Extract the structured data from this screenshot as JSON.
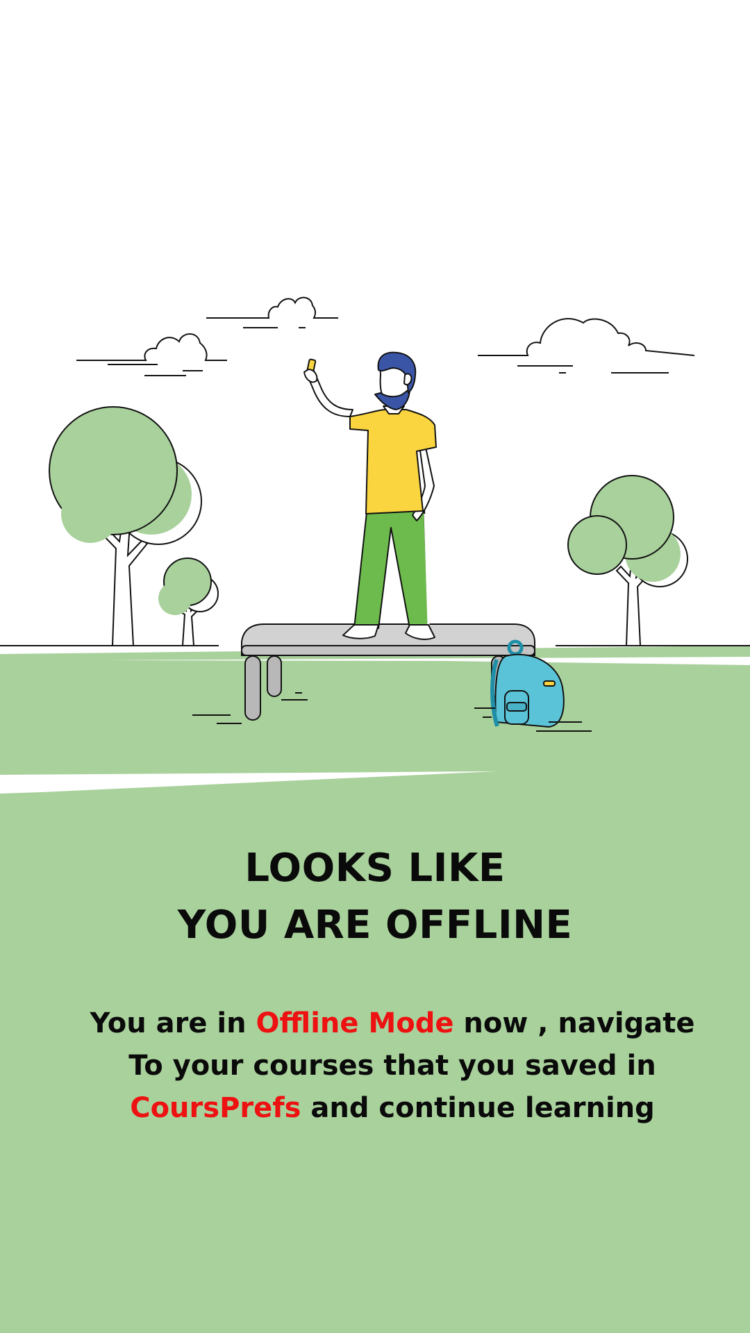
{
  "screen": {
    "name": "offline-screen"
  },
  "headline": {
    "line1": "LOOKS LIKE",
    "line2": "YOU ARE OFFLINE"
  },
  "message": {
    "part1": "You are in ",
    "highlight1": "Offline Mode",
    "part2": " now  , navigate To your courses that you saved in ",
    "highlight2": "CoursPrefs",
    "part3": " and continue learning"
  },
  "colors": {
    "background": "#ffffff",
    "grass": "#a9d19c",
    "text": "#0a0a0a",
    "highlight": "#ee1111",
    "shirt": "#fad53f",
    "pants": "#6cbb4c",
    "hair": "#3b55a6",
    "backpack": "#5bc3d8",
    "bench": "#d2d2d2"
  },
  "icons": {
    "illustration": "person-taking-selfie-in-park-illustration"
  }
}
